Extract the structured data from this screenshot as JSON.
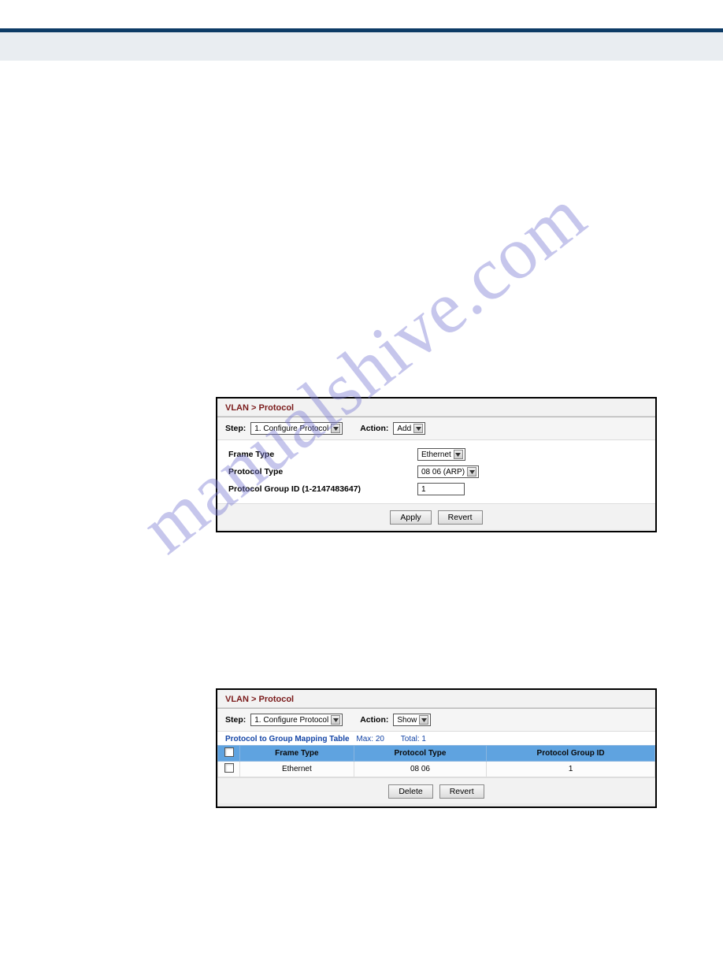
{
  "watermark": "manualshive.com",
  "panel1": {
    "breadcrumb": "VLAN > Protocol",
    "step_label": "Step:",
    "step_value": "1. Configure Protocol",
    "action_label": "Action:",
    "action_value": "Add",
    "fields": {
      "frame_type_label": "Frame Type",
      "frame_type_value": "Ethernet",
      "protocol_type_label": "Protocol Type",
      "protocol_type_value": "08 06 (ARP)",
      "group_id_label": "Protocol Group ID (1-2147483647)",
      "group_id_value": "1"
    },
    "apply_label": "Apply",
    "revert_label": "Revert"
  },
  "panel2": {
    "breadcrumb": "VLAN > Protocol",
    "step_label": "Step:",
    "step_value": "1. Configure Protocol",
    "action_label": "Action:",
    "action_value": "Show",
    "table_title": "Protocol to Group Mapping Table",
    "max_label": "Max: 20",
    "total_label": "Total: 1",
    "headers": {
      "col1": "Frame Type",
      "col2": "Protocol Type",
      "col3": "Protocol Group ID"
    },
    "row": {
      "frame_type": "Ethernet",
      "protocol_type": "08 06",
      "group_id": "1"
    },
    "delete_label": "Delete",
    "revert_label": "Revert"
  }
}
